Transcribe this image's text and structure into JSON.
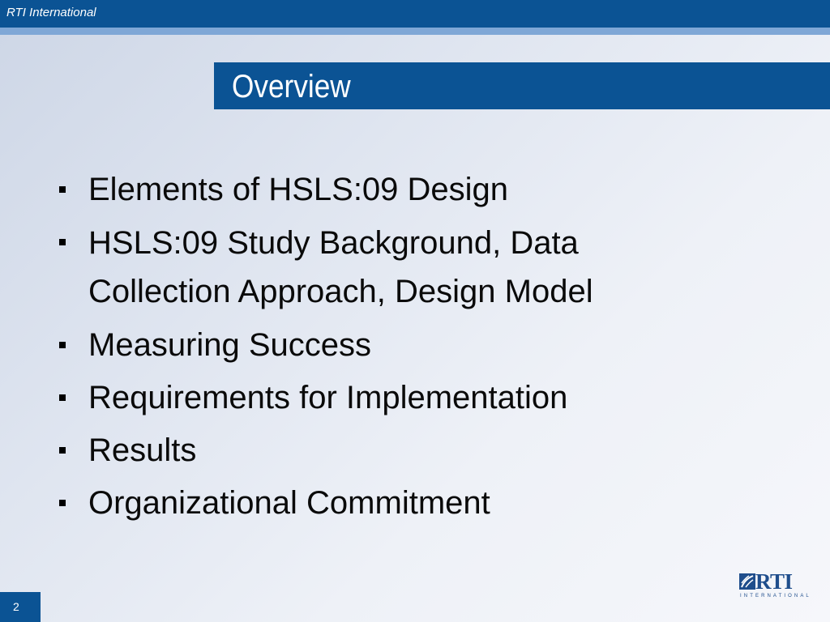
{
  "header": {
    "brand": "RTI International",
    "brand_color": "#0b5394",
    "stripe_color": "#7fa7d6"
  },
  "slide": {
    "title": "Overview",
    "bullets": [
      "Elements of HSLS:09 Design",
      "HSLS:09 Study Background, Data Collection Approach, Design Model",
      "Measuring Success",
      "Requirements for Implementation",
      "Results",
      "Organizational Commitment"
    ]
  },
  "logo": {
    "name": "RTI",
    "subtitle": "INTERNATIONAL",
    "icon": "rti-logo-mark",
    "color": "#1f4e8c"
  },
  "footer": {
    "page_number": "2"
  }
}
